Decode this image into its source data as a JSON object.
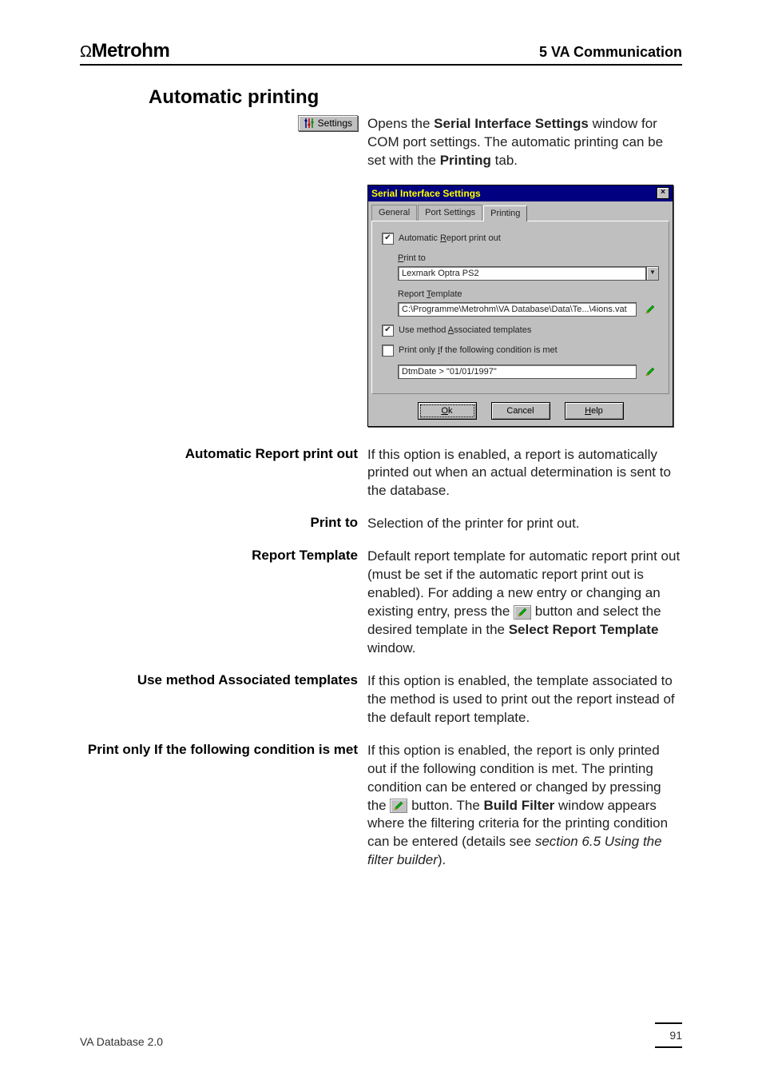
{
  "header": {
    "brand_symbol": "Ω",
    "brand_name": "Metrohm",
    "chapter": "5  VA Communication"
  },
  "section_title": "Automatic printing",
  "settings_button_label": "Settings",
  "intro": {
    "p1a": "Opens the ",
    "p1b_bold": "Serial Interface Settings",
    "p1c": " window for COM port settings. The automatic printing can be set with the ",
    "p1d_bold": "Printing",
    "p1e": " tab."
  },
  "dialog": {
    "title": "Serial Interface Settings",
    "tabs": {
      "general": "General",
      "port": "Port Settings",
      "printing": "Printing"
    },
    "auto_report_label": "Automatic Report print out",
    "print_to_label": "Print to",
    "printer_value": "Lexmark Optra PS2",
    "template_label": "Report Template",
    "template_value": "C:\\Programme\\Metrohm\\VA Database\\Data\\Te...\\4ions.vat",
    "use_assoc_label": "Use method Associated templates",
    "print_only_if_label": "Print only If the following condition is met",
    "condition_value": "DtmDate > \"01/01/1997\"",
    "ok": "Ok",
    "cancel": "Cancel",
    "help": "Help"
  },
  "definitions": {
    "auto_report": {
      "label": "Automatic Report print out",
      "desc": "If this option is enabled, a report is automatically printed out when an actual determination is sent to the database."
    },
    "print_to": {
      "label": "Print to",
      "desc": "Selection of the printer for print out."
    },
    "report_template": {
      "label": "Report Template",
      "desc_a": "Default report template for automatic report print out (must be set if the automatic report print out is enabled). For adding a new entry or changing an existing entry, press the ",
      "desc_b": " button and select the desired template in the ",
      "desc_c_bold": "Select Report Template",
      "desc_d": " window."
    },
    "use_assoc": {
      "label": "Use method Associated templates",
      "desc": "If this option is enabled, the template associated to the method is used to print out the report instead of the default report template."
    },
    "print_only_if": {
      "label": "Print only If the following condition is met",
      "desc_a": "If this option is enabled, the report is only printed out if the following condition is met. The printing condition can be entered or changed by pressing the ",
      "desc_b": " button. The ",
      "desc_c_bold": "Build Filter",
      "desc_d": " window appears where the filtering criteria for the printing condition can be entered (details see ",
      "desc_e_italic": "section 6.5 Using the filter builder",
      "desc_f": ")."
    }
  },
  "footer": {
    "product": "VA Database 2.0",
    "page": "91"
  }
}
